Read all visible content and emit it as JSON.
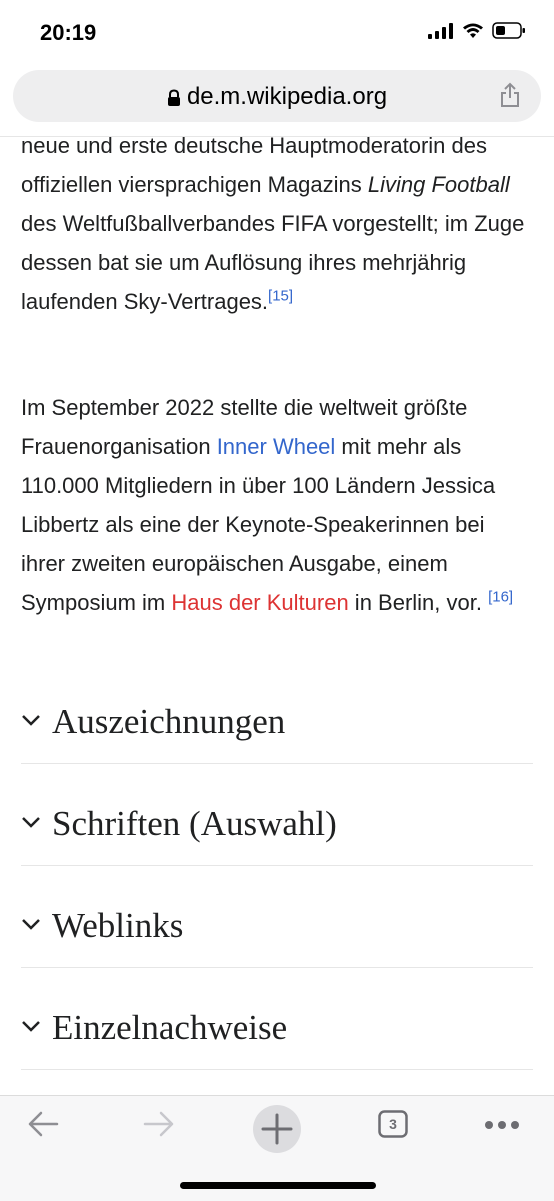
{
  "status": {
    "time": "20:19",
    "battery_icon": "battery-icon",
    "wifi_icon": "wifi-icon",
    "signal_icon": "signal-icon"
  },
  "browser": {
    "url": "de.m.wikipedia.org",
    "tab_count": "3"
  },
  "article": {
    "p1": {
      "t1": "neue und erste deutsche Hauptmoderatorin des offiziellen viersprachigen Magazins ",
      "italic": "Living Football",
      "t2": " des Weltfußballverbandes FIFA vorgestellt; im Zuge dessen bat sie um Auflösung ihres mehrjährig laufenden Sky-Vertrages.",
      "ref": "[15]"
    },
    "p2": {
      "t1": "Im September 2022 stellte die weltweit größte Frauenorganisation ",
      "link1": "Inner Wheel",
      "t2": " mit mehr als 110.000 Mitgliedern in über 100 Ländern Jessica Libbertz als eine der Keynote-Speakerinnen bei ihrer zweiten europäischen Ausgabe, einem Symposium im ",
      "link2": "Haus der Kulturen",
      "t3": " in Berlin, vor. ",
      "ref": "[16]"
    }
  },
  "sections": [
    {
      "title": "Auszeichnungen"
    },
    {
      "title": "Schriften (Auswahl)"
    },
    {
      "title": "Weblinks"
    },
    {
      "title": "Einzelnachweise"
    }
  ],
  "colors": {
    "link": "#3366cc",
    "redlink": "#dd3333"
  }
}
